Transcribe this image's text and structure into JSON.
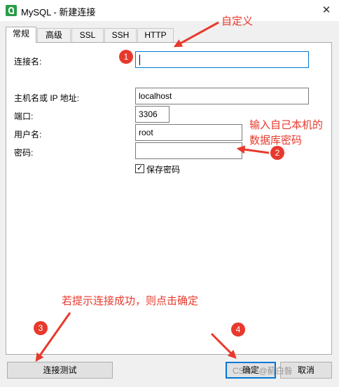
{
  "window": {
    "title": "MySQL - 新建连接",
    "close_glyph": "✕"
  },
  "tabs": [
    {
      "label": "常规"
    },
    {
      "label": "高级"
    },
    {
      "label": "SSL"
    },
    {
      "label": "SSH"
    },
    {
      "label": "HTTP"
    }
  ],
  "form": {
    "connection_name_label": "连接名:",
    "connection_name_value": "",
    "host_label": "主机名或 IP 地址:",
    "host_value": "localhost",
    "port_label": "端口:",
    "port_value": "3306",
    "username_label": "用户名:",
    "username_value": "root",
    "password_label": "密码:",
    "password_value": "",
    "save_password_label": "保存密码",
    "save_password_checked": "✓"
  },
  "buttons": {
    "test_connection": "连接测试",
    "ok": "确定",
    "cancel": "取消"
  },
  "annotations": {
    "custom_text": "自定义",
    "password_text_line1": "输入自己本机的",
    "password_text_line2": "数据库密码",
    "success_text": "若提示连接成功，则点击确定",
    "badge1": "1",
    "badge2": "2",
    "badge3": "3",
    "badge4": "4",
    "color": "#e8392c"
  },
  "watermark": "CSDN @蓟白昝"
}
